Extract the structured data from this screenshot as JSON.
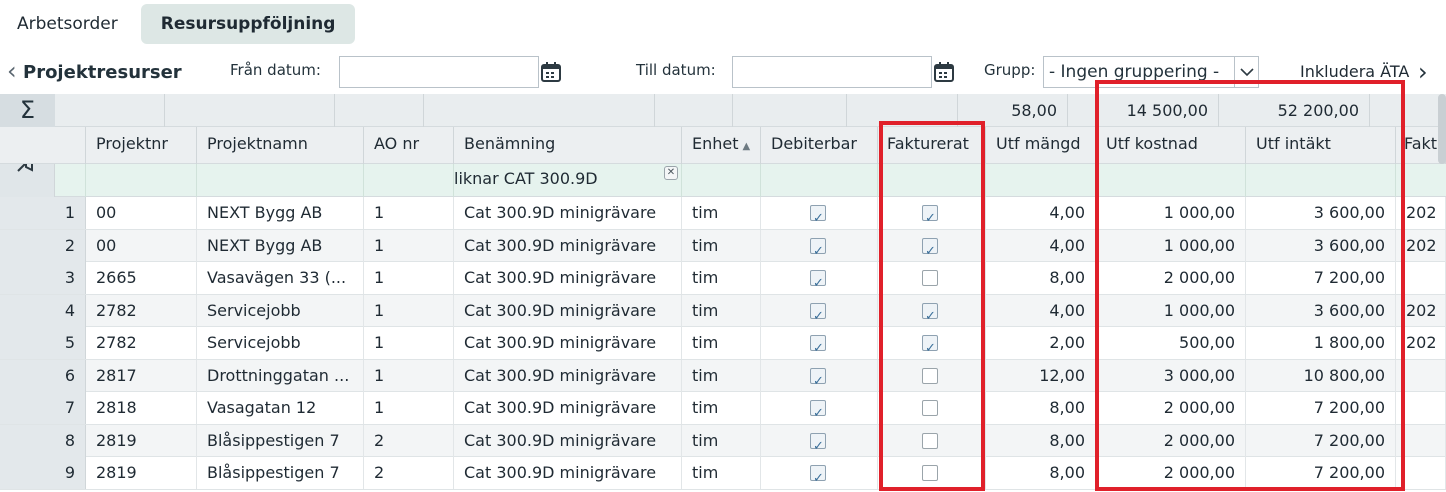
{
  "tabs": [
    "Arbetsorder",
    "Resursuppföljning"
  ],
  "toolbar": {
    "title": "Projektresurser",
    "from_label": "Från datum:",
    "to_label": "Till datum:",
    "group_label": "Grupp:",
    "group_value": "- Ingen gruppering -",
    "include_label": "Inkludera ÄTA"
  },
  "summary": {
    "sigma": "Σ",
    "utf_mangd": "58,00",
    "utf_kostnad": "14 500,00",
    "utf_intakt": "52 200,00"
  },
  "columns": [
    "Projektnr",
    "Projektnamn",
    "AO nr",
    "Benämning",
    "Enhet",
    "Debiterbar",
    "Fakturerat",
    "Utf mängd",
    "Utf kostnad",
    "Utf intäkt",
    "Fakt"
  ],
  "filter": {
    "benamning": "liknar CAT 300.9D"
  },
  "rows": [
    {
      "n": "1",
      "projektnr": "00",
      "projektnamn": "NEXT Bygg AB",
      "ao": "1",
      "benamning": "Cat 300.9D minigrävare",
      "enhet": "tim",
      "debiterbar": true,
      "fakturerat": true,
      "mangd": "4,00",
      "kostnad": "1 000,00",
      "intakt": "3 600,00",
      "fakt": "202"
    },
    {
      "n": "2",
      "projektnr": "00",
      "projektnamn": "NEXT Bygg AB",
      "ao": "1",
      "benamning": "Cat 300.9D minigrävare",
      "enhet": "tim",
      "debiterbar": true,
      "fakturerat": true,
      "mangd": "4,00",
      "kostnad": "1 000,00",
      "intakt": "3 600,00",
      "fakt": "202"
    },
    {
      "n": "3",
      "projektnr": "2665",
      "projektnamn": "Vasavägen 33 (...",
      "ao": "1",
      "benamning": "Cat 300.9D minigrävare",
      "enhet": "tim",
      "debiterbar": true,
      "fakturerat": false,
      "mangd": "8,00",
      "kostnad": "2 000,00",
      "intakt": "7 200,00",
      "fakt": ""
    },
    {
      "n": "4",
      "projektnr": "2782",
      "projektnamn": "Servicejobb",
      "ao": "1",
      "benamning": "Cat 300.9D minigrävare",
      "enhet": "tim",
      "debiterbar": true,
      "fakturerat": true,
      "mangd": "4,00",
      "kostnad": "1 000,00",
      "intakt": "3 600,00",
      "fakt": "202"
    },
    {
      "n": "5",
      "projektnr": "2782",
      "projektnamn": "Servicejobb",
      "ao": "1",
      "benamning": "Cat 300.9D minigrävare",
      "enhet": "tim",
      "debiterbar": true,
      "fakturerat": true,
      "mangd": "2,00",
      "kostnad": "500,00",
      "intakt": "1 800,00",
      "fakt": "202"
    },
    {
      "n": "6",
      "projektnr": "2817",
      "projektnamn": "Drottninggatan ...",
      "ao": "1",
      "benamning": "Cat 300.9D minigrävare",
      "enhet": "tim",
      "debiterbar": true,
      "fakturerat": false,
      "mangd": "12,00",
      "kostnad": "3 000,00",
      "intakt": "10 800,00",
      "fakt": ""
    },
    {
      "n": "7",
      "projektnr": "2818",
      "projektnamn": "Vasagatan 12",
      "ao": "1",
      "benamning": "Cat 300.9D minigrävare",
      "enhet": "tim",
      "debiterbar": true,
      "fakturerat": false,
      "mangd": "8,00",
      "kostnad": "2 000,00",
      "intakt": "7 200,00",
      "fakt": ""
    },
    {
      "n": "8",
      "projektnr": "2819",
      "projektnamn": "Blåsippestigen 7",
      "ao": "2",
      "benamning": "Cat 300.9D minigrävare",
      "enhet": "tim",
      "debiterbar": true,
      "fakturerat": false,
      "mangd": "8,00",
      "kostnad": "2 000,00",
      "intakt": "7 200,00",
      "fakt": ""
    },
    {
      "n": "9",
      "projektnr": "2819",
      "projektnamn": "Blåsippestigen 7",
      "ao": "2",
      "benamning": "Cat 300.9D minigrävare",
      "enhet": "tim",
      "debiterbar": true,
      "fakturerat": false,
      "mangd": "8,00",
      "kostnad": "2 000,00",
      "intakt": "7 200,00",
      "fakt": ""
    }
  ],
  "colors": {
    "highlight": "#e0202a",
    "filter_bg": "#e6f3ee",
    "active_tab": "#dde7e5"
  },
  "icons": {
    "back": "chevron-left-icon",
    "next": "chevron-right-icon",
    "calendar": "calendar-icon",
    "clear_filter": "filter-clear-icon",
    "sum": "sigma-icon"
  }
}
